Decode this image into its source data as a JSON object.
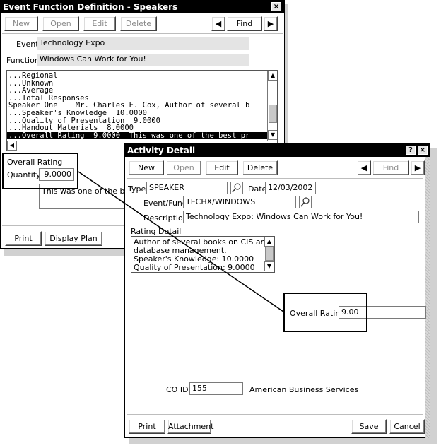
{
  "back_window": {
    "title": "Event Function Definition - Speakers",
    "close_glyph": "×",
    "toolbar": {
      "new": "New",
      "open": "Open",
      "edit": "Edit",
      "delete": "Delete",
      "find": "Find",
      "prev": "◀",
      "next": "▶"
    },
    "event_label": "Event",
    "event_value": "Technology Expo",
    "function_label": "Function",
    "function_value": "Windows Can Work for You!",
    "list_lines": [
      "...Regional",
      "...Unknown",
      "...Average",
      "...Total Responses",
      "Speaker One    Mr. Charles E. Cox, Author of several b",
      "...Speaker's Knowledge  10.0000",
      "...Quality of Presentation  9.0000",
      "...Handout Materials  8.0000",
      "...Overall Rating  9.0000  This was one of the best pr"
    ],
    "rating_label": "Overall Rating",
    "quantity_label": "Quantity",
    "quantity_value": "9.0000",
    "comment_value": "This was one of the best",
    "print": "Print",
    "display_plan": "Display Plan"
  },
  "front_window": {
    "title": "Activity Detail",
    "help_glyph": "?",
    "close_glyph": "×",
    "toolbar": {
      "new": "New",
      "open": "Open",
      "edit": "Edit",
      "delete": "Delete",
      "find": "Find",
      "prev": "◀",
      "next": "▶"
    },
    "type_label": "Type",
    "type_value": "SPEAKER",
    "date_label": "Date",
    "date_value": "12/03/2002",
    "event_func_label": "Event/Func",
    "event_func_value": "TECHX/WINDOWS",
    "description_label": "Description",
    "description_value": "Technology Expo: Windows Can Work for You!",
    "rating_detail_label": "Rating Detail",
    "rating_detail_lines": [
      "Author of several books on CIS and",
      "database management.",
      "Speaker's Knowledge: 10.0000",
      "Quality of Presentation: 9.0000"
    ],
    "overall_rating_label": "Overall Rating",
    "overall_rating_value": "9.00",
    "co_id_label": "CO ID",
    "co_id_value": "155",
    "company_name": "American Business Services",
    "print": "Print",
    "attachment": "Attachment",
    "save": "Save",
    "cancel": "Cancel"
  },
  "icons": {
    "lookup": "search-icon",
    "scroll_up": "▲",
    "scroll_down": "▼",
    "scroll_left": "◀"
  }
}
